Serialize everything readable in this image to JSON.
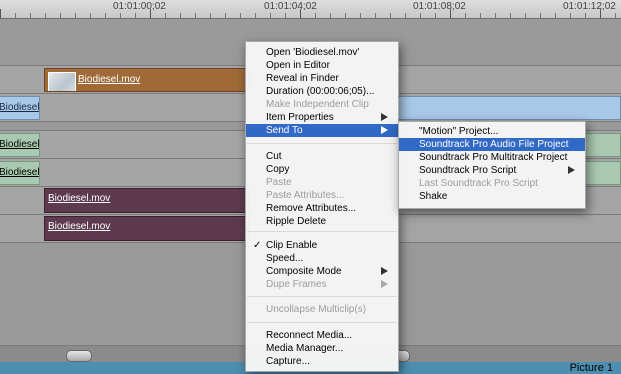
{
  "ruler": {
    "timecodes": [
      "01:01:00;02",
      "01:01:04;02",
      "01:01:08;02",
      "01:01:12;02"
    ]
  },
  "clips": {
    "clip_name": "Biodiesel.mov"
  },
  "context_menu": {
    "items": [
      {
        "label": "Open 'Biodiesel.mov'",
        "enabled": true
      },
      {
        "label": "Open in Editor",
        "enabled": true
      },
      {
        "label": "Reveal in Finder",
        "enabled": true
      },
      {
        "label": "Duration (00:00:06;05)...",
        "enabled": true
      },
      {
        "label": "Make Independent Clip",
        "enabled": false
      },
      {
        "label": "Item Properties",
        "enabled": true,
        "submenu": true
      },
      {
        "label": "Send To",
        "enabled": true,
        "submenu": true,
        "highlighted": true
      },
      {
        "label": "Cut",
        "enabled": true
      },
      {
        "label": "Copy",
        "enabled": true
      },
      {
        "label": "Paste",
        "enabled": false
      },
      {
        "label": "Paste Attributes...",
        "enabled": false
      },
      {
        "label": "Remove Attributes...",
        "enabled": true
      },
      {
        "label": "Ripple Delete",
        "enabled": true
      },
      {
        "label": "Clip Enable",
        "enabled": true,
        "checked": true
      },
      {
        "label": "Speed...",
        "enabled": true
      },
      {
        "label": "Composite Mode",
        "enabled": true,
        "submenu": true
      },
      {
        "label": "Dupe Frames",
        "enabled": false,
        "submenu": true
      },
      {
        "label": "Uncollapse Multiclip(s)",
        "enabled": false
      },
      {
        "label": "Reconnect Media...",
        "enabled": true
      },
      {
        "label": "Media Manager...",
        "enabled": true
      },
      {
        "label": "Capture...",
        "enabled": true
      }
    ],
    "check_glyph": "✓"
  },
  "submenu": {
    "items": [
      {
        "label": "\"Motion\" Project...",
        "enabled": true
      },
      {
        "label": "Soundtrack Pro Audio File Project",
        "enabled": true,
        "highlighted": true
      },
      {
        "label": "Soundtrack Pro Multitrack Project",
        "enabled": true
      },
      {
        "label": "Soundtrack Pro Script",
        "enabled": true,
        "submenu": true
      },
      {
        "label": "Last Soundtrack Pro Script",
        "enabled": false
      },
      {
        "label": "Shake",
        "enabled": true
      }
    ]
  },
  "status": {
    "picture_label": "Picture 1"
  },
  "colors": {
    "highlight": "#3169c6",
    "video_clip": "#a06a38",
    "audio_clip": "#5e3a4e",
    "linked_clip": "#a8c8e6"
  }
}
